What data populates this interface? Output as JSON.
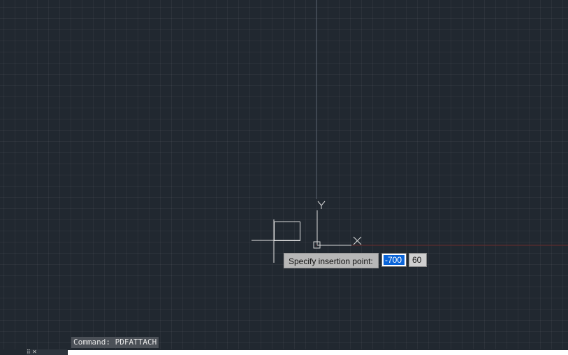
{
  "tooltip": {
    "prompt": "Specify insertion point:"
  },
  "coordinates": {
    "first_value": "-700",
    "second_value": "60"
  },
  "ucs_icon": {
    "x_label": "X",
    "y_label": "Y"
  },
  "command_line": {
    "history_text": "Command: PDFATTACH",
    "input_value": "",
    "handle_glyphs": "⠿ ✕"
  },
  "colors": {
    "background": "#212830",
    "axis_x": "#6a2b2b",
    "axis_y": "#55606b",
    "selection": "#0a64d8"
  }
}
